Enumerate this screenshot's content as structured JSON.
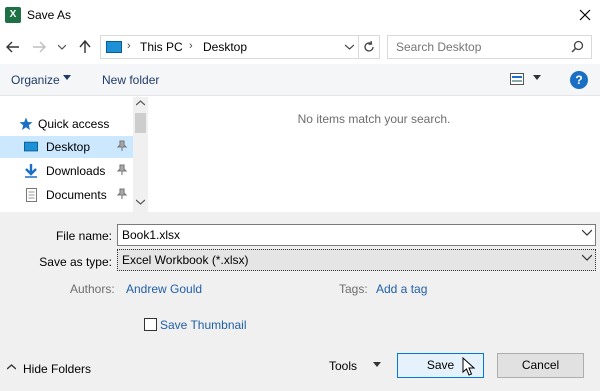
{
  "window": {
    "title": "Save As",
    "app_icon_letter": "X"
  },
  "address": {
    "segments": [
      "This PC",
      "Desktop"
    ],
    "search_placeholder": "Search Desktop"
  },
  "toolbar": {
    "organize_label": "Organize",
    "new_folder_label": "New folder",
    "help_label": "?"
  },
  "nav": {
    "items": [
      {
        "label": "Quick access",
        "icon": "star-icon"
      },
      {
        "label": "Desktop",
        "icon": "desktop-folder-icon",
        "selected": true
      },
      {
        "label": "Downloads",
        "icon": "download-arrow-icon"
      },
      {
        "label": "Documents",
        "icon": "documents-icon"
      }
    ]
  },
  "content": {
    "empty_message": "No items match your search."
  },
  "form": {
    "file_name_label": "File name:",
    "file_name_value": "Book1.xlsx",
    "save_type_label": "Save as type:",
    "save_type_value": "Excel Workbook (*.xlsx)",
    "authors_label": "Authors:",
    "authors_value": "Andrew Gould",
    "tags_label": "Tags:",
    "tags_value": "Add a tag",
    "thumbnail_label": "Save Thumbnail",
    "thumbnail_checked": false
  },
  "footer": {
    "hide_folders_label": "Hide Folders",
    "tools_label": "Tools",
    "save_label": "Save",
    "cancel_label": "Cancel"
  },
  "colors": {
    "excel_green": "#1e7145",
    "selection": "#cce8ff",
    "link": "#1f5fa8",
    "accent_button_border": "#0078d7"
  }
}
